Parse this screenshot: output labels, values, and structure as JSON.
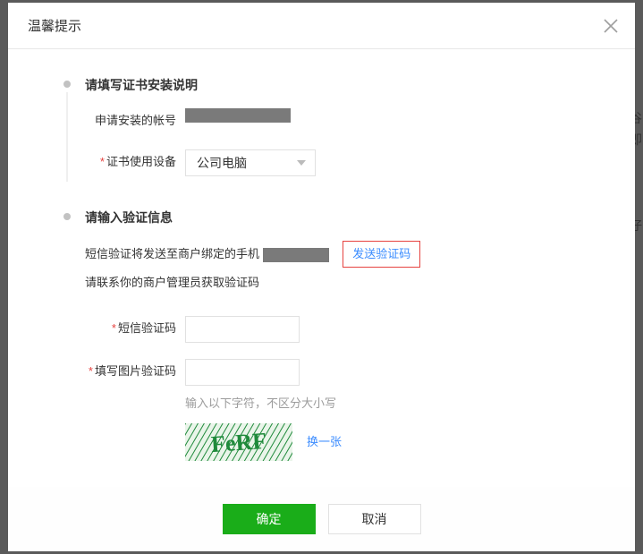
{
  "dialog": {
    "title": "温馨提示",
    "close_icon": "close",
    "confirm_label": "确定",
    "cancel_label": "取消"
  },
  "step1": {
    "title": "请填写证书安装说明",
    "account_label": "申请安装的帐号",
    "device_label": "证书使用设备",
    "device_value": "公司电脑"
  },
  "step2": {
    "title": "请输入验证信息",
    "note1_prefix": "短信验证将发送至商户绑定的手机",
    "send_code": "发送验证码",
    "note2": "请联系你的商户管理员获取验证码",
    "sms_label": "短信验证码",
    "captcha_label": "填写图片验证码",
    "captcha_hint": "输入以下字符，不区分大小写",
    "captcha_text": "FeRF",
    "refresh": "换一张"
  }
}
